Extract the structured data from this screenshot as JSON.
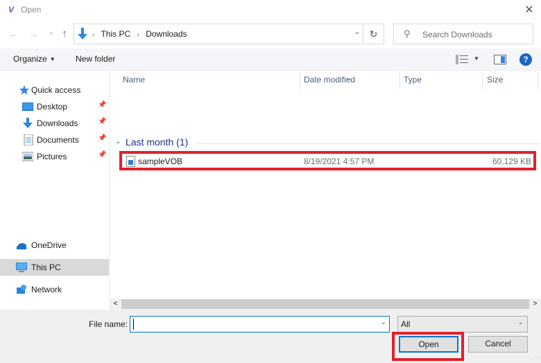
{
  "window": {
    "title": "Open",
    "app_icon": "app-logo-icon",
    "close_icon": "close-icon"
  },
  "nav": {
    "back_icon": "arrow-left-icon",
    "forward_icon": "arrow-right-icon",
    "recent_icon": "chevron-down-icon",
    "up_icon": "arrow-up-icon",
    "address": {
      "icon": "downloads-icon",
      "crumbs": [
        "This PC",
        "Downloads"
      ],
      "separator": "›"
    },
    "refresh_icon": "refresh-icon",
    "search": {
      "placeholder": "Search Downloads",
      "icon": "search-icon"
    }
  },
  "toolbar": {
    "organize_label": "Organize",
    "new_folder_label": "New folder",
    "view_icon": "view-details-icon",
    "preview_icon": "preview-pane-icon",
    "help_label": "?"
  },
  "sidebar": {
    "quick_access": {
      "label": "Quick access",
      "icon": "star-icon"
    },
    "pinned": [
      {
        "label": "Desktop",
        "icon": "desktop-icon"
      },
      {
        "label": "Downloads",
        "icon": "downloads-icon"
      },
      {
        "label": "Documents",
        "icon": "documents-icon"
      },
      {
        "label": "Pictures",
        "icon": "pictures-icon"
      }
    ],
    "locations": [
      {
        "label": "OneDrive",
        "icon": "cloud-icon",
        "selected": false
      },
      {
        "label": "This PC",
        "icon": "computer-icon",
        "selected": true
      },
      {
        "label": "Network",
        "icon": "network-icon",
        "selected": false
      }
    ]
  },
  "file_list": {
    "columns": [
      "Name",
      "Date modified",
      "Type",
      "Size"
    ],
    "groups": [
      {
        "label": "Last month (1)",
        "files": [
          {
            "name": "sampleVOB",
            "date_modified": "8/19/2021 4:57 PM",
            "type": "",
            "size": "60,129 KB",
            "icon": "video-file-icon"
          }
        ]
      }
    ]
  },
  "footer": {
    "file_name_label": "File name:",
    "file_name_value": "",
    "file_type_selected": "All",
    "open_label": "Open",
    "cancel_label": "Cancel"
  },
  "colors": {
    "highlight": "#e2202a",
    "accent": "#0078d7",
    "group_label": "#1e3287"
  }
}
